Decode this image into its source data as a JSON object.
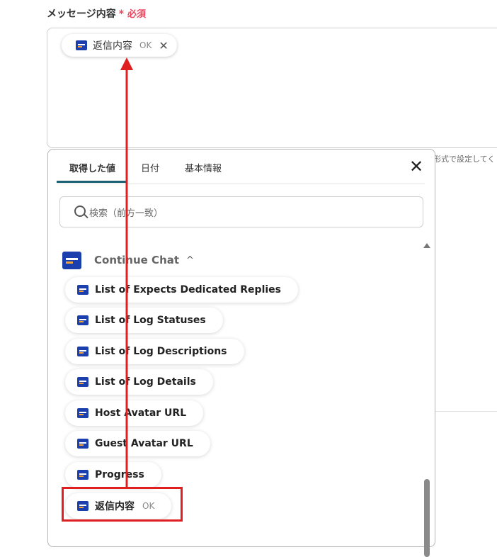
{
  "field": {
    "label": "メッセージ内容",
    "star": "*",
    "required": "必須"
  },
  "message_chip": {
    "icon": "data-source-icon",
    "label": "返信内容",
    "sub": "OK",
    "close": "✕"
  },
  "right_hint": "形式で設定してく",
  "popup": {
    "tabs": [
      {
        "label": "取得した値",
        "active": true
      },
      {
        "label": "日付",
        "active": false
      },
      {
        "label": "基本情報",
        "active": false
      }
    ],
    "close": "✕",
    "search_placeholder": "検索（前方一致）",
    "group": {
      "label": "Continue Chat",
      "chevron": "^"
    },
    "items": [
      {
        "label": "List of Expects Dedicated Replies",
        "sub": ""
      },
      {
        "label": "List of Log Statuses",
        "sub": ""
      },
      {
        "label": "List of Log Descriptions",
        "sub": ""
      },
      {
        "label": "List of Log Details",
        "sub": ""
      },
      {
        "label": "Host Avatar URL",
        "sub": ""
      },
      {
        "label": "Guest Avatar URL",
        "sub": ""
      },
      {
        "label": "Progress",
        "sub": ""
      },
      {
        "label": "返信内容",
        "sub": "OK"
      }
    ]
  },
  "annotation": {
    "highlight_color": "#e02020",
    "arrow_color": "#e02020"
  }
}
